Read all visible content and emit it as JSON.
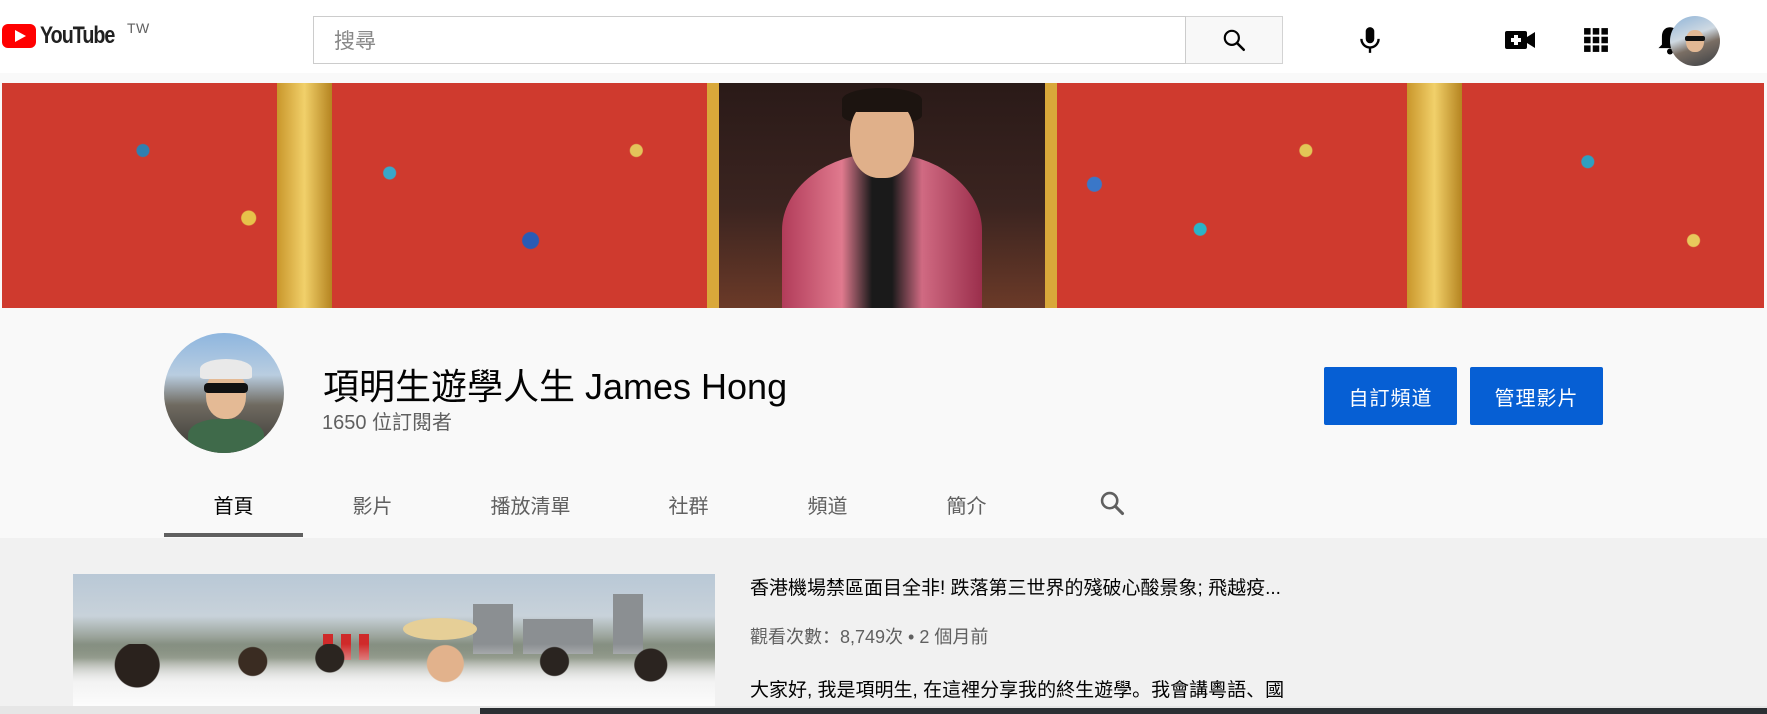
{
  "header": {
    "logo_text": "YouTube",
    "region": "TW",
    "search_placeholder": "搜尋",
    "icons": [
      "search-icon",
      "mic-icon",
      "create-video-icon",
      "apps-icon",
      "notifications-icon",
      "account-avatar"
    ]
  },
  "channel": {
    "name": "項明生遊學人生 James Hong",
    "subscribers": "1650 位訂閱者",
    "customize_label": "自訂頻道",
    "manage_label": "管理影片"
  },
  "tabs": [
    {
      "label": "首頁",
      "active": true
    },
    {
      "label": "影片",
      "active": false
    },
    {
      "label": "播放清單",
      "active": false
    },
    {
      "label": "社群",
      "active": false
    },
    {
      "label": "頻道",
      "active": false
    },
    {
      "label": "簡介",
      "active": false
    }
  ],
  "featured_video": {
    "title": "香港機場禁區面目全非! 跌落第三世界的殘破心酸景象; 飛越疫...",
    "meta": "觀看次數：8,749次 • 2 個月前",
    "description": "大家好, 我是項明生, 在這裡分享我的終生遊學。我會講粵語、國"
  },
  "colors": {
    "brand_red": "#ff0000",
    "button_blue": "#065fd4",
    "text_primary": "#030303",
    "text_secondary": "#606060"
  }
}
